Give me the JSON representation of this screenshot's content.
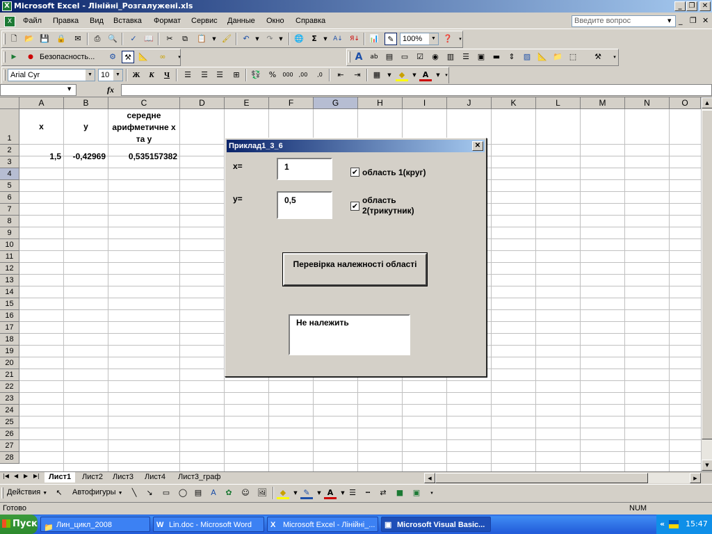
{
  "window": {
    "title": "Microsoft Excel - Лінійні_Розгалужені.xls"
  },
  "menu": {
    "items": [
      "Файл",
      "Правка",
      "Вид",
      "Вставка",
      "Формат",
      "Сервис",
      "Данные",
      "Окно",
      "Справка"
    ],
    "ask_placeholder": "Введите вопрос"
  },
  "toolbar": {
    "zoom": "100%",
    "security_label": "Безопасность...",
    "font_name": "Arial Cyr",
    "font_size": "10"
  },
  "formula_bar": {
    "fx_label": "fx",
    "name_box": "",
    "formula": ""
  },
  "sheet": {
    "columns": [
      "A",
      "B",
      "C",
      "D",
      "E",
      "F",
      "G",
      "H",
      "I",
      "J",
      "K",
      "L",
      "M",
      "N",
      "O"
    ],
    "rows": [
      "1",
      "2",
      "3",
      "4",
      "5",
      "6",
      "7",
      "8",
      "9",
      "10",
      "11",
      "12",
      "13",
      "14",
      "15",
      "16",
      "17",
      "18",
      "19",
      "20",
      "21",
      "22",
      "23",
      "24",
      "25",
      "26",
      "27",
      "28"
    ],
    "header_x": "x",
    "header_y": "y",
    "header_mean": "середне арифметичне х та у",
    "value_x": "1,5",
    "value_y": "-0,42969",
    "value_mean": "0,535157382"
  },
  "tabs": [
    "Лист1",
    "Лист2",
    "Лист3",
    "Лист4",
    "Лист3_граф"
  ],
  "drawing": {
    "actions": "Действия",
    "autoshapes": "Автофигуры"
  },
  "status": {
    "ready": "Готово",
    "num": "NUM"
  },
  "taskbar": {
    "start": "Пуск",
    "tasks": [
      "Лин_цикл_2008",
      "Lin.doc - Microsoft Word",
      "Microsoft Excel - Лінійні_...",
      "Microsoft Visual Basic..."
    ],
    "time": "15:47",
    "tray_arrow": "«"
  },
  "dialog": {
    "title": "Приклад1_3_6",
    "x_label": "x=",
    "x_value": "1",
    "y_label": "y=",
    "y_value": "0,5",
    "check1_label": "область 1(круг)",
    "check2_label": "область 2(трикутник)",
    "check_mark": "✔",
    "button_label": "Перевірка належності області",
    "result": "Не належить"
  }
}
